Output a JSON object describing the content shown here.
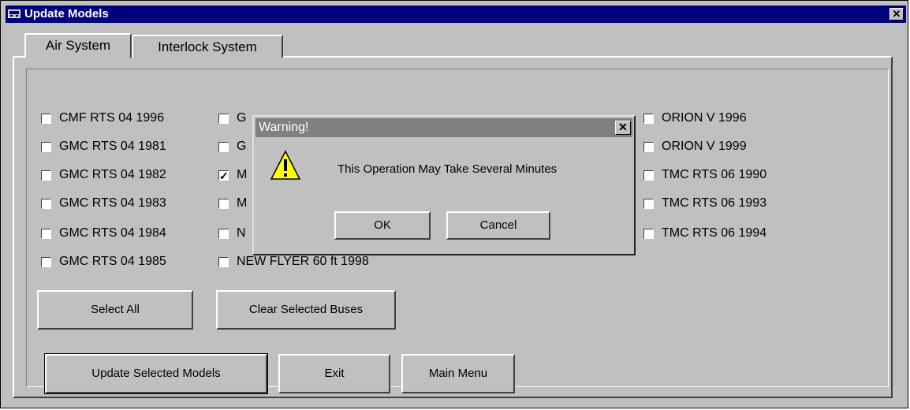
{
  "window": {
    "title": "Update Models",
    "icon": "app-window-icon"
  },
  "tabs": [
    "Air System",
    "Interlock System"
  ],
  "checkboxes": [
    {
      "label": "CMF RTS 04 1996",
      "checked": false
    },
    {
      "label": "GMC RTS 04 1981",
      "checked": false
    },
    {
      "label": "GMC RTS 04 1982",
      "checked": false
    },
    {
      "label": "GMC RTS 04 1983",
      "checked": false
    },
    {
      "label": "GMC RTS 04 1984",
      "checked": false
    },
    {
      "label": "GMC RTS 04 1985",
      "checked": false
    },
    {
      "label": "G",
      "checked": false
    },
    {
      "label": "G",
      "checked": false
    },
    {
      "label": "M",
      "checked": true
    },
    {
      "label": "M",
      "checked": false
    },
    {
      "label": "N",
      "checked": false
    },
    {
      "label": "NEW FLYER 60 ft 1998",
      "checked": false
    },
    {
      "label": "ORION V 1996",
      "checked": false
    },
    {
      "label": "ORION V 1999",
      "checked": false
    },
    {
      "label": "TMC RTS 06 1990",
      "checked": false
    },
    {
      "label": "TMC RTS 06 1993",
      "checked": false
    },
    {
      "label": "TMC RTS 06 1994",
      "checked": false
    }
  ],
  "buttons": {
    "select_all": "Select All",
    "clear_selected": "Clear Selected Buses",
    "update_selected": "Update Selected Models",
    "exit": "Exit",
    "main_menu": "Main Menu"
  },
  "dialog": {
    "title": "Warning!",
    "message": "This Operation May Take Several Minutes",
    "ok": "OK",
    "cancel": "Cancel",
    "icon": "warning-icon"
  },
  "colors": {
    "titlebar_active": "#00007c",
    "titlebar_inactive": "#808080",
    "face": "#c0c0c0"
  }
}
